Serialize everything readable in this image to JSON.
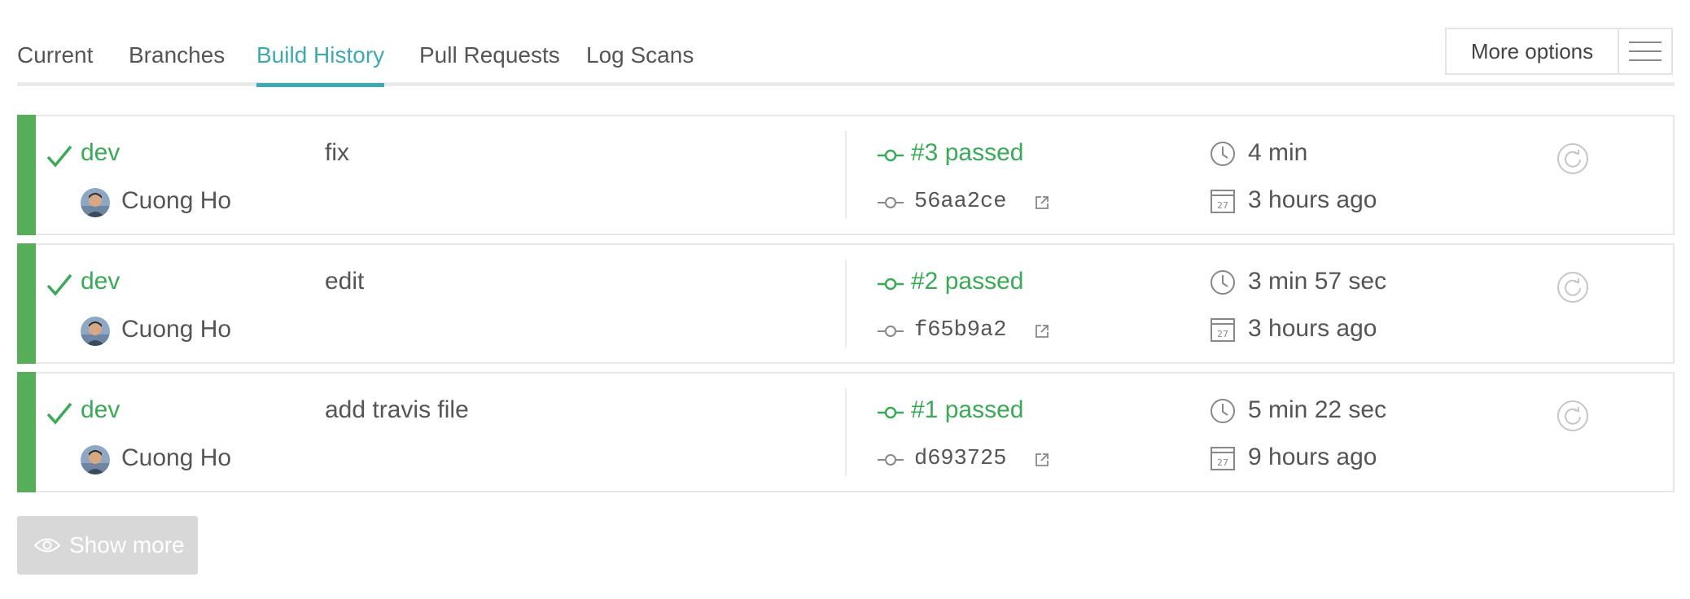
{
  "tabs": [
    {
      "label": "Current",
      "active": false
    },
    {
      "label": "Branches",
      "active": false
    },
    {
      "label": "Build History",
      "active": true
    },
    {
      "label": "Pull Requests",
      "active": false
    },
    {
      "label": "Log Scans",
      "active": false
    }
  ],
  "more_options": {
    "label": "More options"
  },
  "builds": [
    {
      "branch": "dev",
      "author": "Cuong Ho",
      "message": "fix",
      "status": "#3 passed",
      "sha": "56aa2ce",
      "duration": "4 min",
      "finished": "3 hours ago"
    },
    {
      "branch": "dev",
      "author": "Cuong Ho",
      "message": "edit",
      "status": "#2 passed",
      "sha": "f65b9a2",
      "duration": "3 min 57 sec",
      "finished": "3 hours ago"
    },
    {
      "branch": "dev",
      "author": "Cuong Ho",
      "message": "add travis file",
      "status": "#1 passed",
      "sha": "d693725",
      "duration": "5 min 22 sec",
      "finished": "9 hours ago"
    }
  ],
  "calendar_day": "27",
  "show_more": {
    "label": "Show more"
  },
  "colors": {
    "accent": "#3eaaaf",
    "passed": "#39aa56",
    "stripe": "#57ae59",
    "button_disabled": "#d8d8d8"
  }
}
